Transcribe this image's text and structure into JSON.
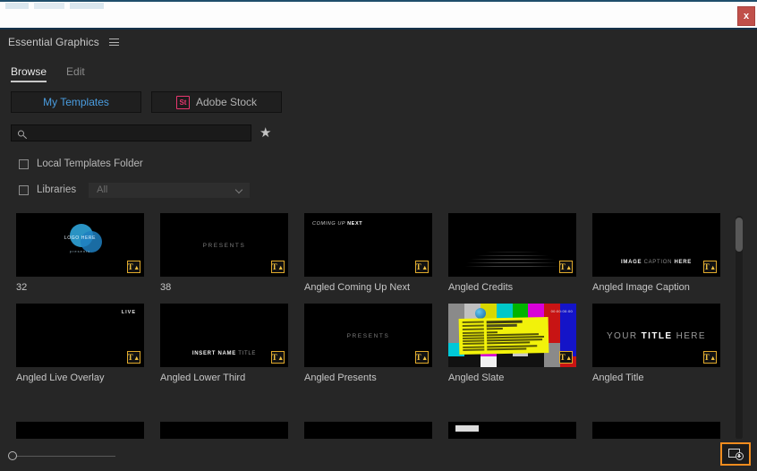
{
  "window": {
    "close_label": "x"
  },
  "panel": {
    "title": "Essential Graphics",
    "menu_icon": "hamburger-menu-icon"
  },
  "tabs": [
    {
      "label": "Browse",
      "active": true
    },
    {
      "label": "Edit",
      "active": false
    }
  ],
  "source_buttons": [
    {
      "label": "My Templates",
      "active": true,
      "icon": ""
    },
    {
      "label": "Adobe Stock",
      "active": false,
      "icon": "St"
    }
  ],
  "search": {
    "value": "",
    "placeholder": "",
    "icon": "search-icon",
    "favorite_icon": "★"
  },
  "filters": {
    "local_templates": {
      "label": "Local Templates Folder",
      "checked": false
    },
    "libraries": {
      "label": "Libraries",
      "checked": false
    },
    "libraries_select": {
      "value": "All"
    }
  },
  "templates": [
    {
      "name": "32",
      "art": "logo",
      "logo_text": "LOGO HERE",
      "logo_sub": "presents",
      "badge": "T"
    },
    {
      "name": "38",
      "art": "center-text",
      "center_text": "PRESENTS",
      "badge": "T"
    },
    {
      "name": "Angled Coming Up Next",
      "art": "coming-up-next",
      "lead": "COMING UP ",
      "strong": "NEXT",
      "badge": "T"
    },
    {
      "name": "Angled Credits",
      "art": "credits",
      "badge": "T"
    },
    {
      "name": "Angled Image Caption",
      "art": "image-caption",
      "cap_a": "IMAGE ",
      "cap_b": "CAPTION ",
      "cap_c": "HERE",
      "badge": "T"
    },
    {
      "name": "Angled Live Overlay",
      "art": "live",
      "live_text": "LIVE",
      "badge": "T"
    },
    {
      "name": "Angled Lower Third",
      "art": "lower-third",
      "l3_a": "INSERT NAME ",
      "l3_b": "TITLE",
      "badge": "T"
    },
    {
      "name": "Angled Presents",
      "art": "center-text",
      "center_text": "PRESENTS",
      "badge": "T"
    },
    {
      "name": "Angled Slate",
      "art": "slate",
      "slate_timecode": "00:00:00:00",
      "slate_fields": [
        {
          "key": "Project",
          "value": "Project Name"
        },
        {
          "key": "Client",
          "value": "Client Name"
        },
        {
          "key": "Date",
          "value": "Date"
        },
        {
          "key": "Spot",
          "value": "1/1"
        },
        {
          "key": "Director",
          "value": "Director Name"
        },
        {
          "key": "Camera",
          "value": "Camera Info"
        },
        {
          "key": "Notes",
          "value": "Notes here"
        },
        {
          "key": "Aspect",
          "value": "16:9"
        },
        {
          "key": "Audio",
          "value": "Stereo"
        },
        {
          "key": "Codec",
          "value": "ProRes"
        }
      ],
      "badge": "T"
    },
    {
      "name": "Angled Title",
      "art": "title",
      "t_a": "YOUR ",
      "t_b": "TITLE",
      "t_c": " HERE",
      "badge": "T"
    }
  ],
  "footer": {
    "zoom_slider": {
      "value": 0,
      "name": "thumbnail-size-slider"
    },
    "new_layer_icon": "new-layer-icon"
  },
  "colors": {
    "background": "#262626",
    "accent_blue": "#4a9de0",
    "stock_red": "#e8376f",
    "highlight_orange": "#f08c1e",
    "badge_yellow": "#f0c040",
    "close_red": "#c0504a"
  }
}
